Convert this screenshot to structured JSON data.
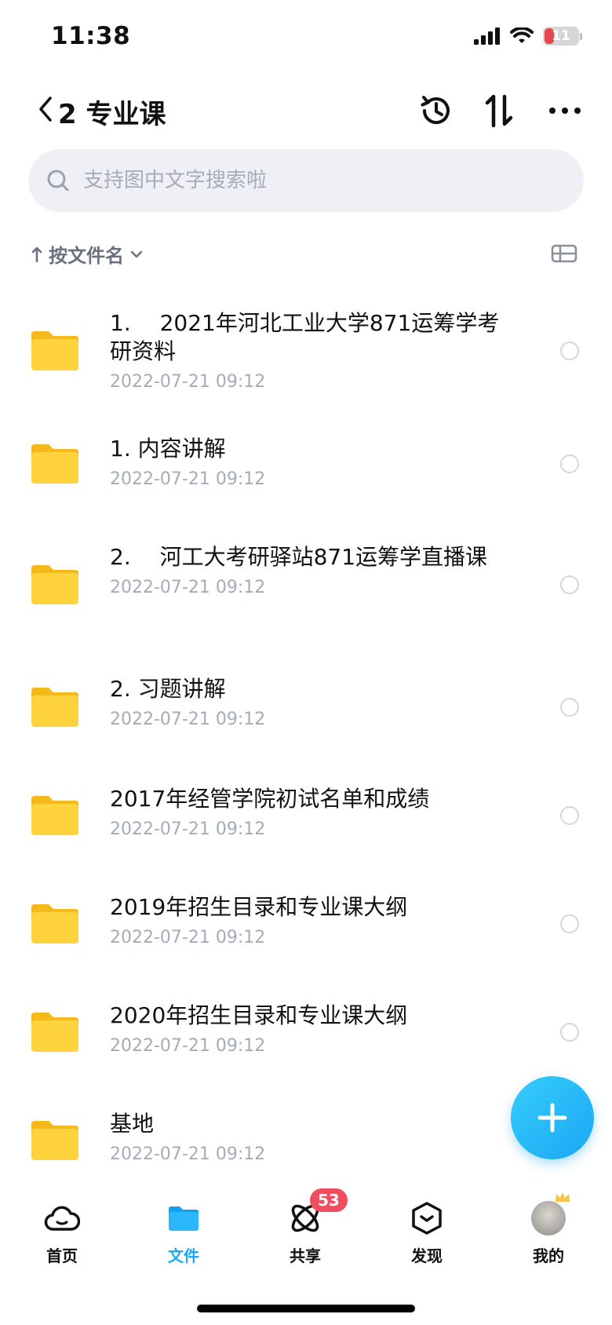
{
  "status_bar": {
    "time": "11:38",
    "battery": "11"
  },
  "header": {
    "title": "2 专业课"
  },
  "search": {
    "placeholder": "支持图中文字搜索啦"
  },
  "sort": {
    "label": "按文件名"
  },
  "files": [
    {
      "name": "1.　 2021年河北工业大学871运筹学考研资料",
      "date": "2022-07-21 09:12"
    },
    {
      "name": "1. 内容讲解",
      "date": "2022-07-21 09:12"
    },
    {
      "name": "2.　 河工大考研驿站871运筹学直播课",
      "date": "2022-07-21 09:12"
    },
    {
      "name": "2. 习题讲解",
      "date": "2022-07-21 09:12"
    },
    {
      "name": "2017年经管学院初试名单和成绩",
      "date": "2022-07-21 09:12"
    },
    {
      "name": "2019年招生目录和专业课大纲",
      "date": "2022-07-21 09:12"
    },
    {
      "name": "2020年招生目录和专业课大纲",
      "date": "2022-07-21 09:12"
    },
    {
      "name": "基地",
      "date": "2022-07-21 09:12"
    }
  ],
  "tabs": [
    {
      "label": "首页",
      "icon": "cloud-icon"
    },
    {
      "label": "文件",
      "icon": "folder-icon",
      "active": true
    },
    {
      "label": "共享",
      "icon": "share-icon",
      "badge": "53"
    },
    {
      "label": "发现",
      "icon": "discover-icon"
    },
    {
      "label": "我的",
      "icon": "avatar"
    }
  ],
  "colors": {
    "accent": "#1aa7f4",
    "folder": "#ffcf33",
    "badge": "#f04e5e"
  }
}
